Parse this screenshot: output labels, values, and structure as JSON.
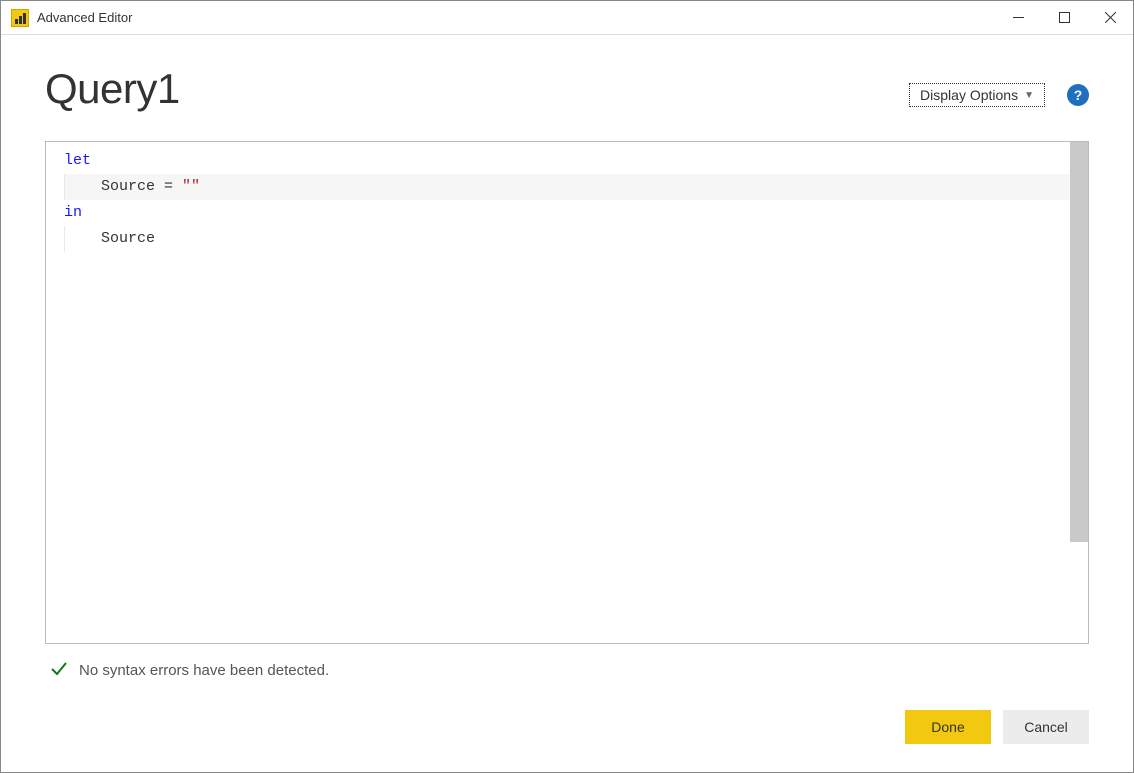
{
  "window": {
    "title": "Advanced Editor"
  },
  "header": {
    "query_name": "Query1",
    "display_options_label": "Display Options"
  },
  "editor": {
    "lines": {
      "l1_kw": "let",
      "l2_ident": "    Source = ",
      "l2_str": "\"\"",
      "l3_kw": "in",
      "l4_ident": "    Source"
    }
  },
  "status": {
    "message": "No syntax errors have been detected."
  },
  "buttons": {
    "done": "Done",
    "cancel": "Cancel"
  }
}
